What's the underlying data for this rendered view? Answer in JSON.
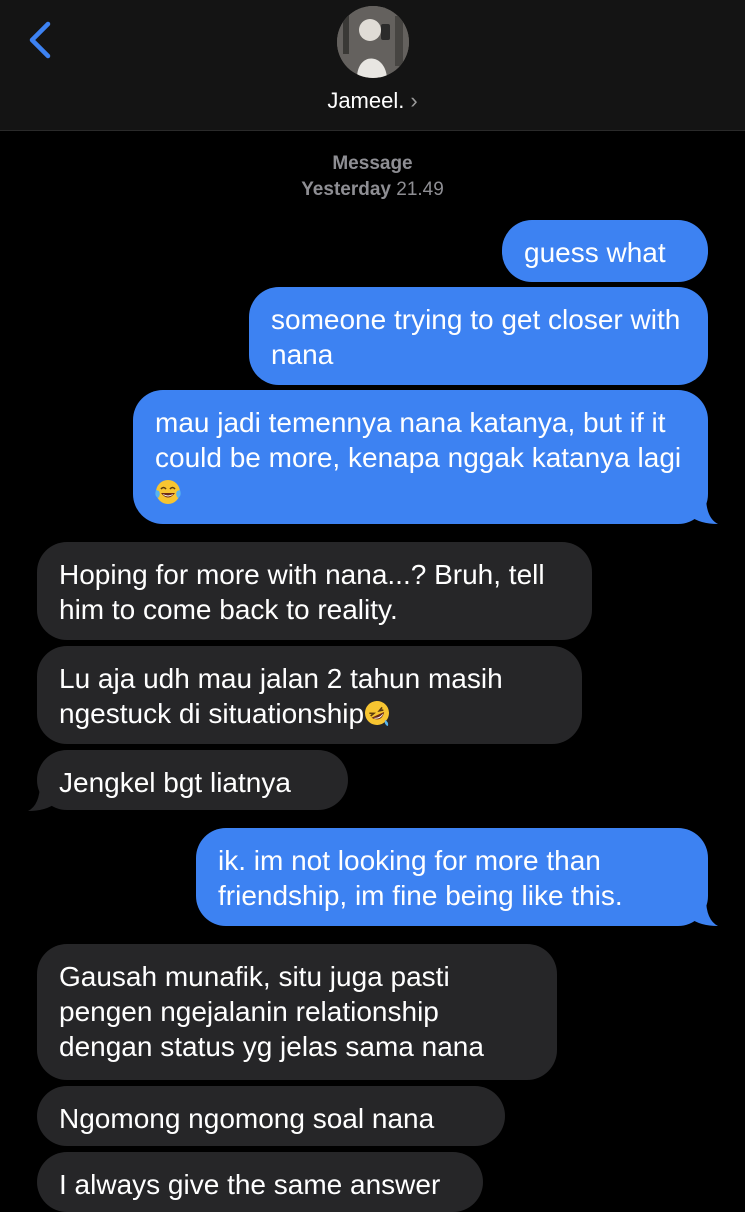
{
  "header": {
    "contact_name": "Jameel.",
    "chevron": "›",
    "back_icon": "chevron-left-icon"
  },
  "thread": {
    "service_label": "Message",
    "day_label": "Yesterday",
    "time_label": "21.49"
  },
  "messages": [
    {
      "direction": "outgoing",
      "text": "guess what"
    },
    {
      "direction": "outgoing",
      "text": "someone trying to get closer with nana"
    },
    {
      "direction": "outgoing",
      "text": "mau jadi temennya nana katanya, but if it could be more, kenapa nggak katanya lagi",
      "emoji": "face-with-tears-of-joy"
    },
    {
      "direction": "incoming",
      "text": "Hoping for more with nana...? Bruh, tell him to come back to reality."
    },
    {
      "direction": "incoming",
      "text": "Lu aja udh mau jalan 2 tahun masih ngestuck di situationship",
      "emoji": "rolling-on-the-floor-laughing"
    },
    {
      "direction": "incoming",
      "text": "Jengkel bgt liatnya"
    },
    {
      "direction": "outgoing",
      "text": "ik. im not looking for more than friendship, im fine being like this."
    },
    {
      "direction": "incoming",
      "text": "Gausah munafik, situ juga pasti pengen ngejalanin relationship dengan status yg jelas sama nana"
    },
    {
      "direction": "incoming",
      "text": "Ngomong ngomong soal nana"
    },
    {
      "direction": "incoming",
      "text": "I always give the same answer"
    }
  ],
  "colors": {
    "outgoing_bubble": "#3d82f2",
    "incoming_bubble": "#262628",
    "accent": "#3d82f2",
    "background": "#000000"
  }
}
